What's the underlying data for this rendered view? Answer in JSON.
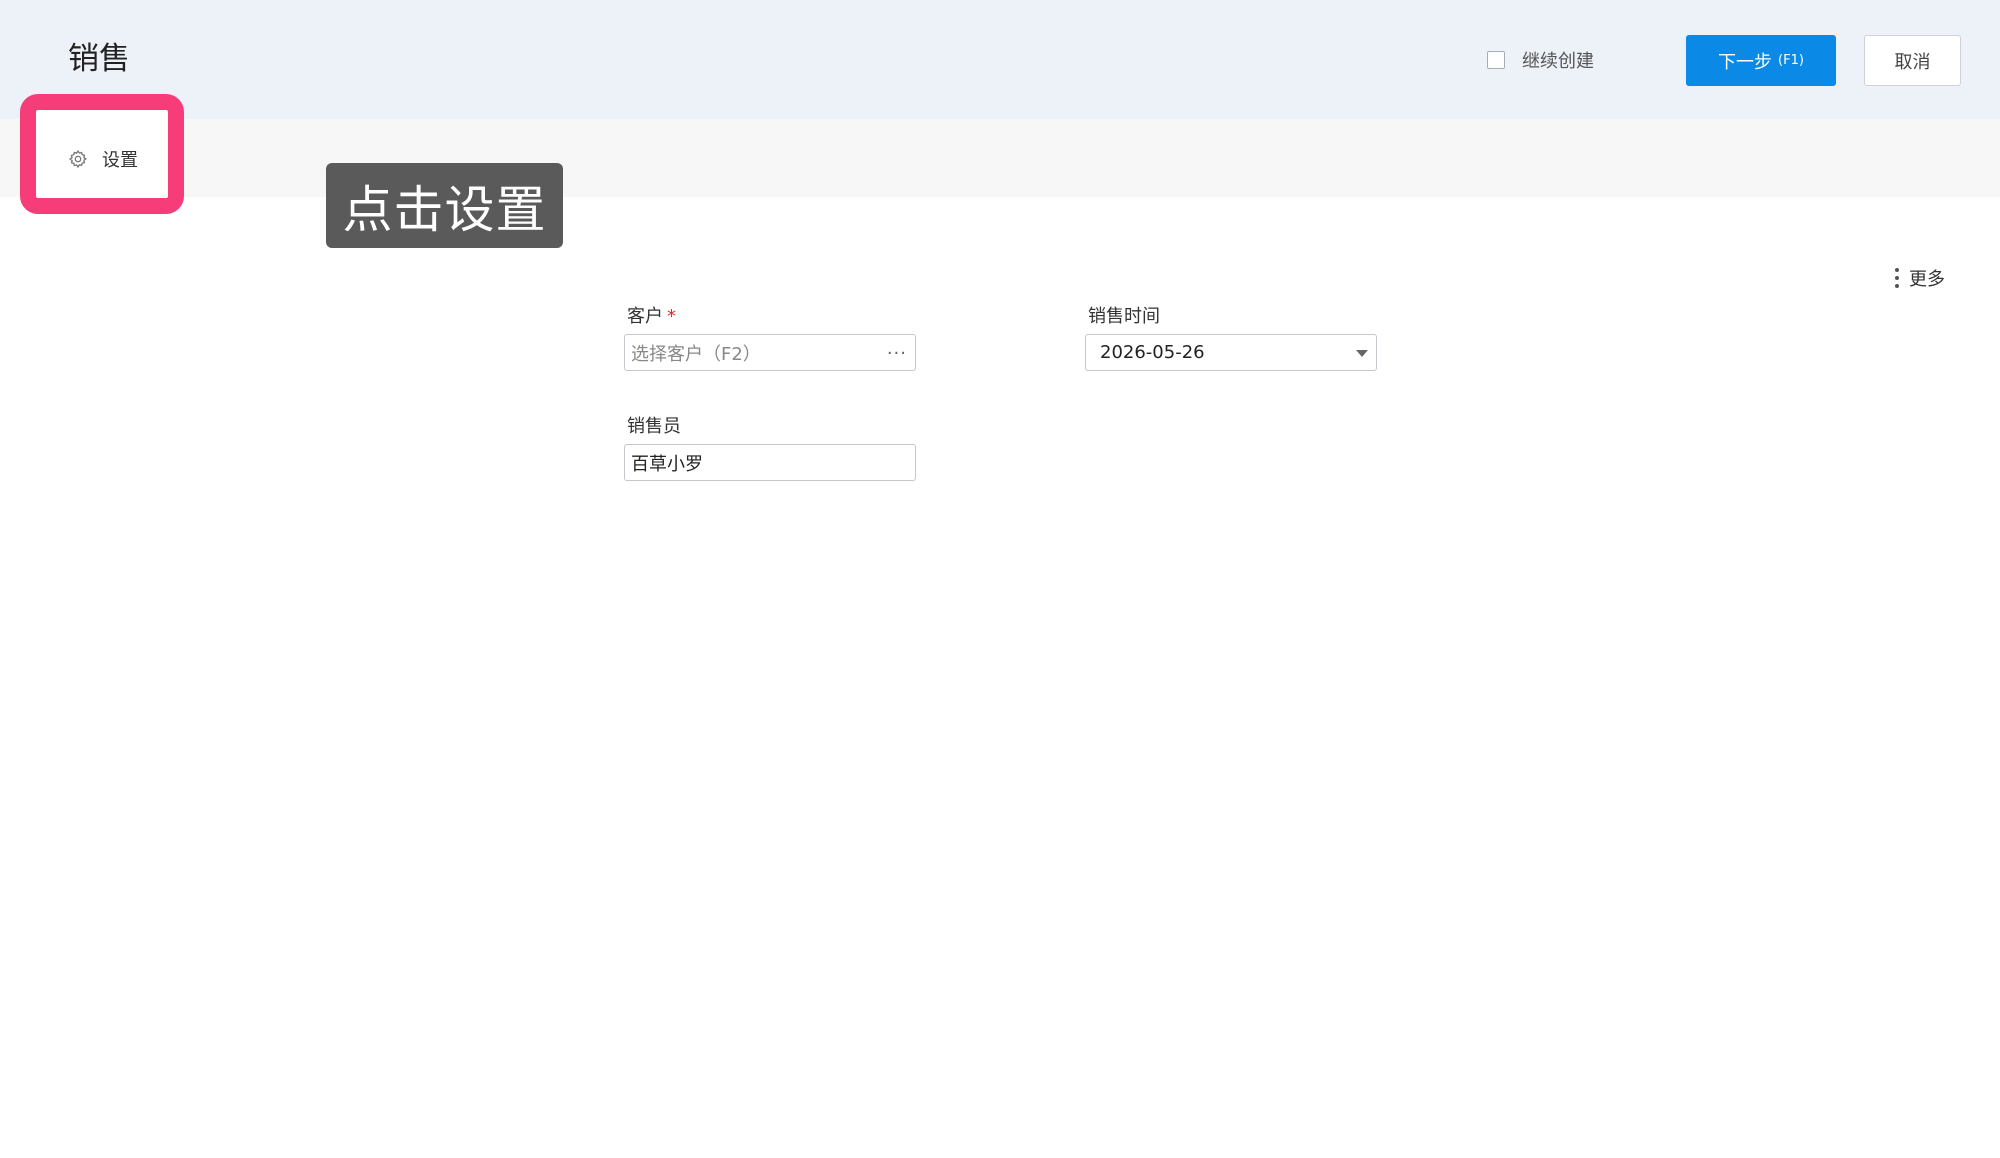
{
  "header": {
    "title": "销售",
    "continue_create_label": "继续创建",
    "continue_create_checked": false,
    "next_button_label": "下一步",
    "next_button_key": "(F1)",
    "cancel_button_label": "取消"
  },
  "toolbar": {
    "settings_label": "设置",
    "more_label": "更多"
  },
  "tooltip": {
    "text": "点击设置"
  },
  "form": {
    "customer": {
      "label": "客户",
      "required_mark": "*",
      "placeholder": "选择客户（F2）",
      "value": ""
    },
    "sale_time": {
      "label": "销售时间",
      "value": "2026-05-26"
    },
    "salesperson": {
      "label": "销售员",
      "value": "百草小罗"
    }
  },
  "colors": {
    "primary": "#0a8ae6",
    "highlight": "#f63d7a",
    "header_bg": "#edf1f8",
    "toolbar_bg": "#f7f7f7",
    "tooltip_bg": "#5a5a5a",
    "required": "#e02a2a"
  },
  "icons": {
    "settings": "gear-icon",
    "more": "vertical-dots-icon",
    "customer_picker": "ellipsis-icon",
    "date_dropdown": "caret-down-icon"
  }
}
